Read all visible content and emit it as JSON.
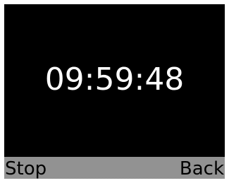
{
  "display": {
    "timer_value": "09:59:48"
  },
  "softkeys": {
    "left_label": "Stop",
    "right_label": "Back"
  },
  "colors": {
    "screen_background": "#000000",
    "timer_text": "#ffffff",
    "softkey_bar": "#8a8a8a",
    "softkey_text": "#000000"
  }
}
